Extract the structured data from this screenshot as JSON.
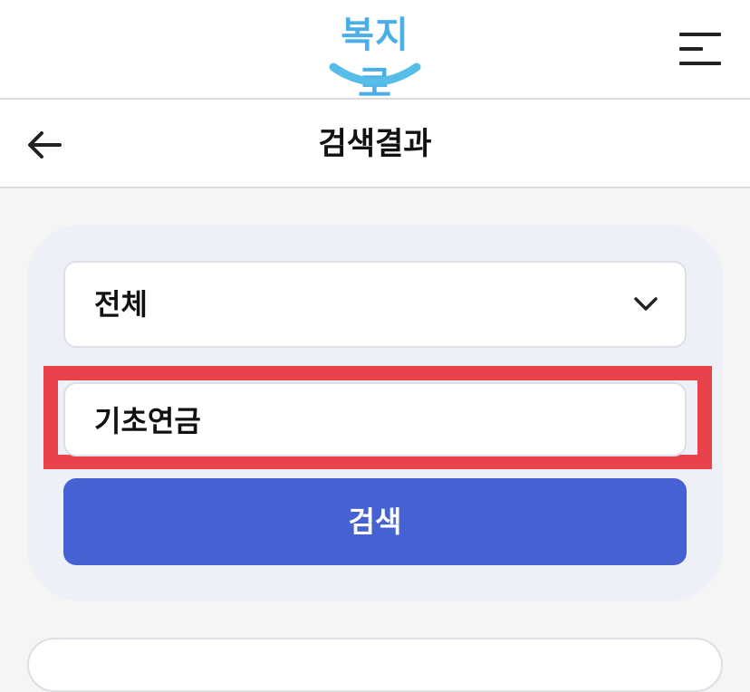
{
  "header": {
    "logo_text": "복지로",
    "logo_color": "#4aaee8",
    "menu_icon": "hamburger-menu-icon"
  },
  "subheader": {
    "back_icon": "arrow-left-icon",
    "title": "검색결과"
  },
  "search": {
    "category_select": {
      "value": "전체",
      "icon": "chevron-down-icon"
    },
    "keyword_input": {
      "value": "기초연금"
    },
    "submit_label": "검색",
    "highlight_color": "#e8434b",
    "button_color": "#4662d2"
  }
}
